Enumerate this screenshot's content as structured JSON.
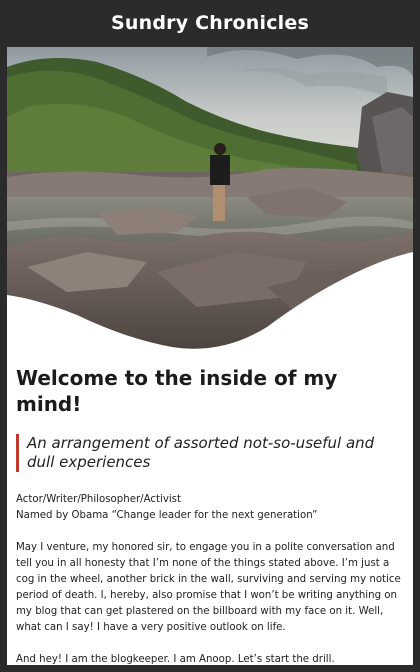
{
  "header": {
    "site_title": "Sundry Chronicles"
  },
  "hero": {
    "image_icon": "landscape-photo"
  },
  "main": {
    "title": "Welcome to the inside of my mind!",
    "tagline": "An arrangement of assorted not-so-useful and dull experiences",
    "bio_line1": "Actor/Writer/Philosopher/Activist",
    "bio_line2": "Named by Obama “Change leader for the next generation”",
    "paragraph1": "May I venture, my honored sir, to engage you in a polite conversation and tell you in all honesty that I’m none of the things stated above. I’m just a cog in the wheel, another brick in the wall, surviving and serving my notice period of death. I, hereby, also promise that I won’t be writing anything on my blog that can get plastered on the billboard with my face on it. Well, what can I say! I have a very positive outlook on life.",
    "paragraph2": "And hey! I am the blogkeeper. I am Anoop. Let’s start the drill."
  },
  "colors": {
    "background": "#2b2b2b",
    "card": "#ffffff",
    "accent": "#c0392b"
  }
}
